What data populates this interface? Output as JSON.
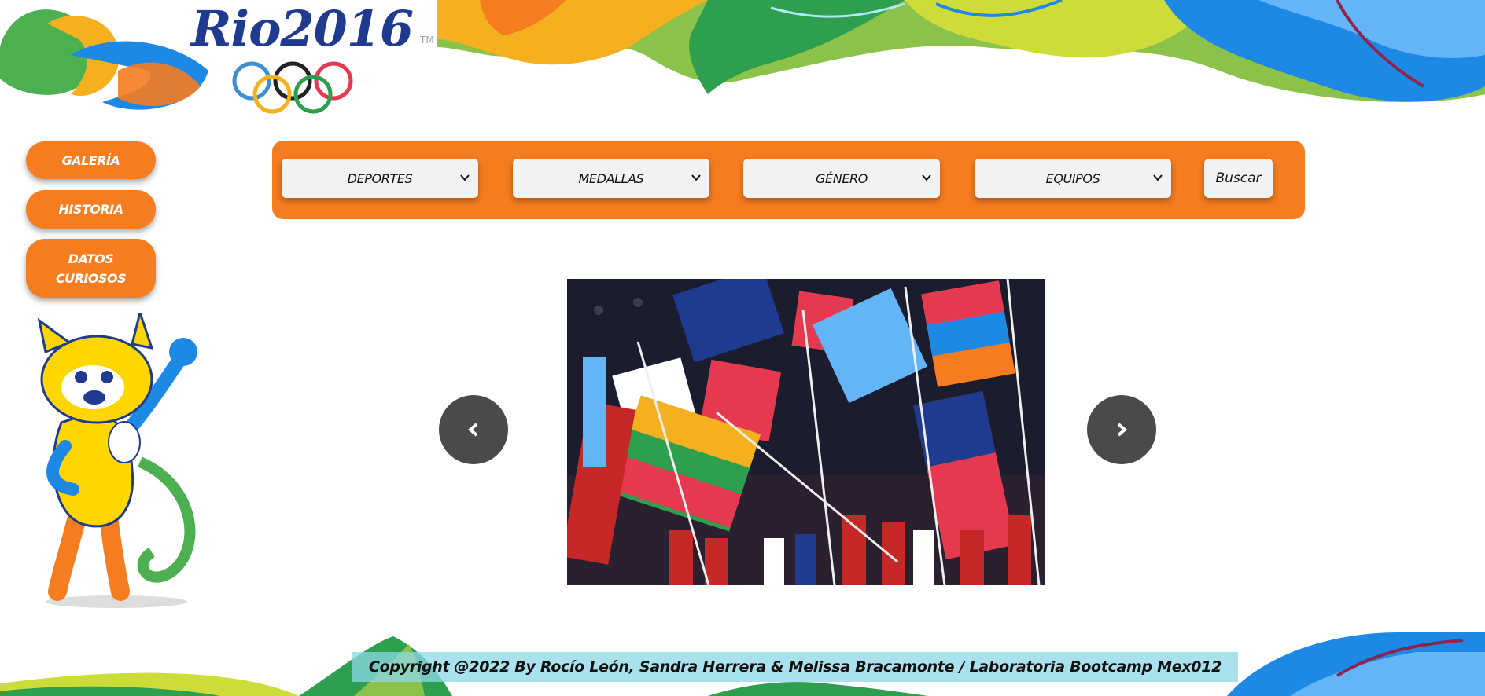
{
  "brand": {
    "logo_text": "Rio2016",
    "trademark": "TM"
  },
  "side_menu": {
    "items": [
      {
        "label": "GALERÍA"
      },
      {
        "label": "HISTORIA"
      },
      {
        "label": "DATOS CURIOSOS"
      }
    ]
  },
  "filters": {
    "selects": [
      {
        "label": "DEPORTES"
      },
      {
        "label": "MEDALLAS"
      },
      {
        "label": "GÉNERO"
      },
      {
        "label": "EQUIPOS"
      }
    ],
    "search_label": "Buscar"
  },
  "carousel": {
    "prev_icon": "chevron-left-icon",
    "next_icon": "chevron-right-icon",
    "image": "flags-ceremony-photo"
  },
  "footer": {
    "copyright": "Copyright @2022 By Rocío León, Sandra Herrera & Melissa Bracamonte / Laboratoria Bootcamp Mex012"
  },
  "colors": {
    "accent": "#f57c1f",
    "nav_arrow": "#4a4a4a",
    "logo_blue": "#1e3b8f"
  }
}
